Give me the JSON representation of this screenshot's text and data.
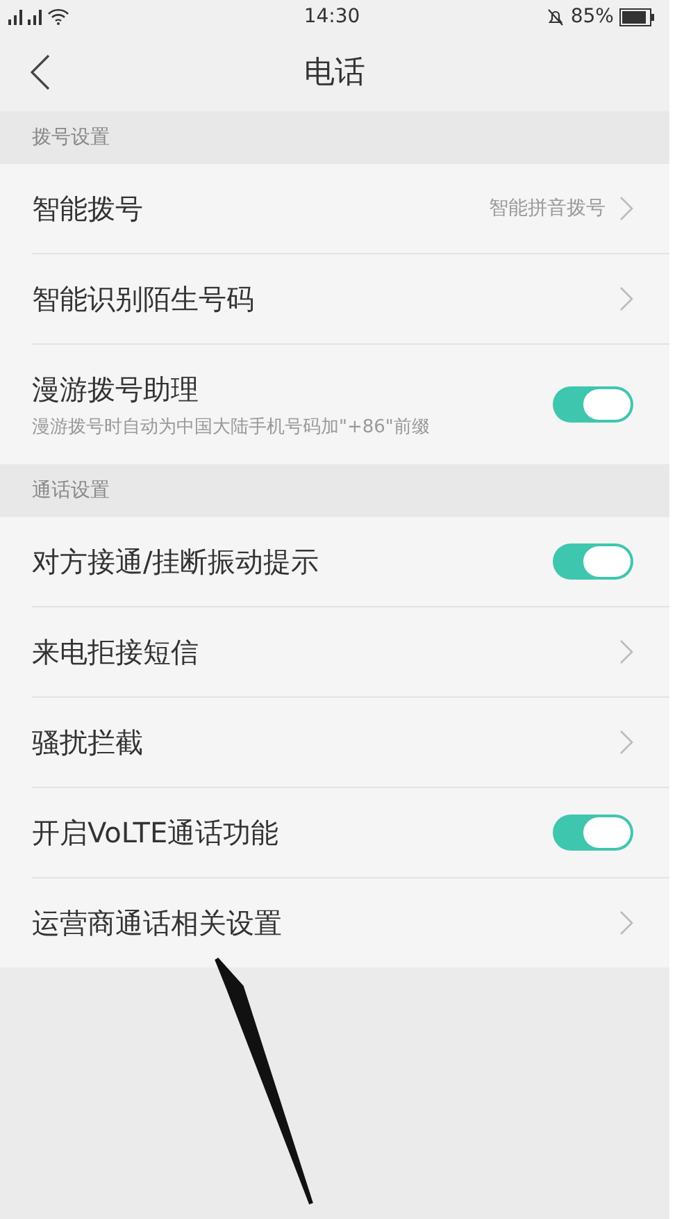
{
  "status_bar": {
    "time": "14:30",
    "battery": "85%"
  },
  "header": {
    "title": "电话"
  },
  "sections": [
    {
      "title": "拨号设置",
      "rows": [
        {
          "kind": "link",
          "label": "智能拨号",
          "value": "智能拼音拨号"
        },
        {
          "kind": "link",
          "label": "智能识别陌生号码"
        },
        {
          "kind": "toggle",
          "label": "漫游拨号助理",
          "subtitle": "漫游拨号时自动为中国大陆手机号码加\"+86\"前缀",
          "on": true
        }
      ]
    },
    {
      "title": "通话设置",
      "rows": [
        {
          "kind": "toggle",
          "label": "对方接通/挂断振动提示",
          "on": true
        },
        {
          "kind": "link",
          "label": "来电拒接短信"
        },
        {
          "kind": "link",
          "label": "骚扰拦截"
        },
        {
          "kind": "toggle",
          "label": "开启VoLTE通话功能",
          "on": true
        },
        {
          "kind": "link",
          "label": "运营商通话相关设置"
        }
      ]
    }
  ]
}
